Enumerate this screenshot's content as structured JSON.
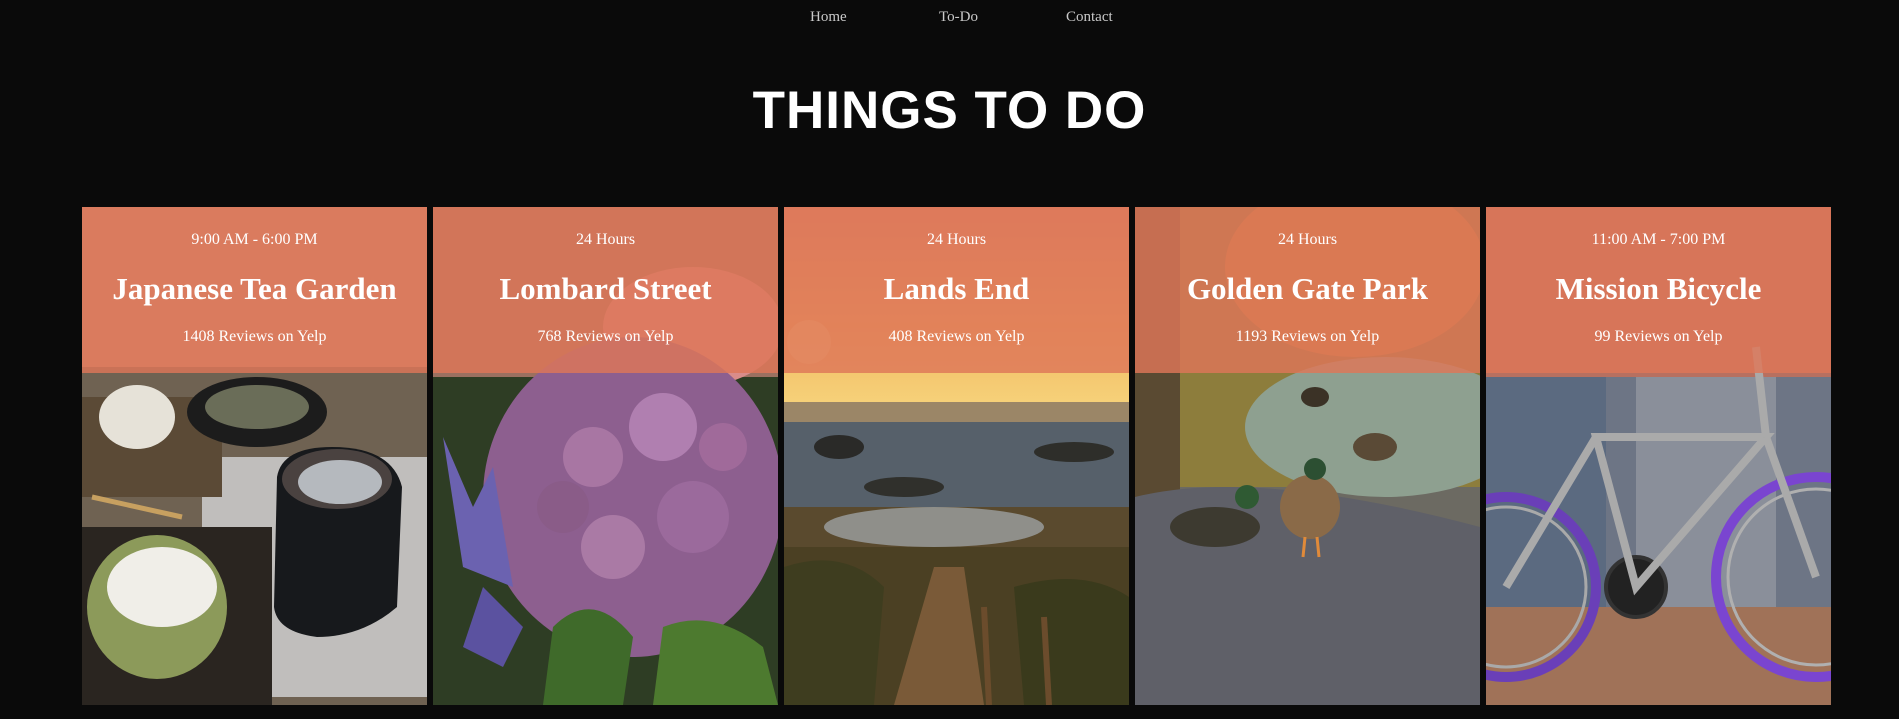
{
  "nav": {
    "home": "Home",
    "todo": "To-Do",
    "contact": "Contact"
  },
  "page_title": "THINGS TO DO",
  "cards": [
    {
      "hours": "9:00 AM - 6:00 PM",
      "name": "Japanese Tea Garden",
      "reviews": "1408 Reviews on Yelp",
      "image": "matcha-tea-and-dessert-photo"
    },
    {
      "hours": "24 Hours",
      "name": "Lombard Street",
      "reviews": "768 Reviews on Yelp",
      "image": "purple-hydrangea-flowers-photo"
    },
    {
      "hours": "24 Hours",
      "name": "Lands End",
      "reviews": "408 Reviews on Yelp",
      "image": "ocean-sunset-coastline-photo"
    },
    {
      "hours": "24 Hours",
      "name": "Golden Gate Park",
      "reviews": "1193 Reviews on Yelp",
      "image": "ducks-by-pond-photo"
    },
    {
      "hours": "11:00 AM - 7:00 PM",
      "name": "Mission Bicycle",
      "reviews": "99 Reviews on Yelp",
      "image": "bicycle-on-street-photo"
    }
  ],
  "colors": {
    "background": "#0a0a0a",
    "overlay": "#de7658",
    "text": "#ffffff"
  }
}
